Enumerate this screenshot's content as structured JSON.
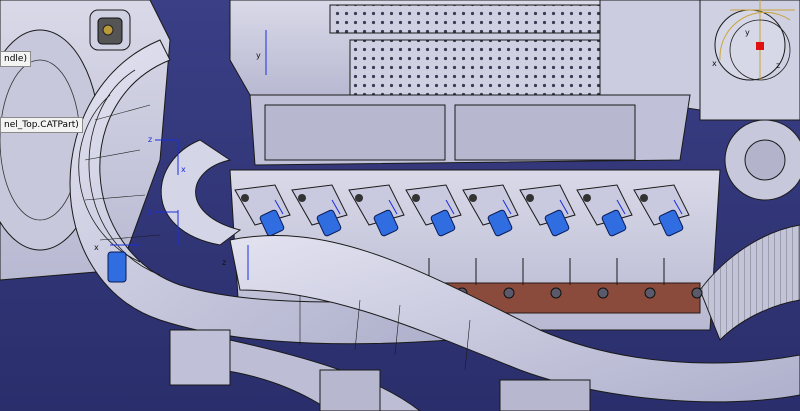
{
  "viewer": {
    "background_top": "#3a3f86",
    "background_bottom": "#2a2e6b",
    "model_color": "#c9c9dc",
    "edge_color": "#1a1a1a",
    "rail_color": "#8a4a3c",
    "connector_color": "#2f6de0",
    "axis_color": "#1a2ee0"
  },
  "tree": {
    "node_1": "ndle)",
    "node_2": "nel_Top.CATPart)"
  },
  "axes": {
    "x": "x",
    "y": "y",
    "z": "z"
  },
  "compass": {
    "icon": "compass-icon",
    "axis_x": "x",
    "axis_y": "y",
    "axis_z": "z"
  }
}
